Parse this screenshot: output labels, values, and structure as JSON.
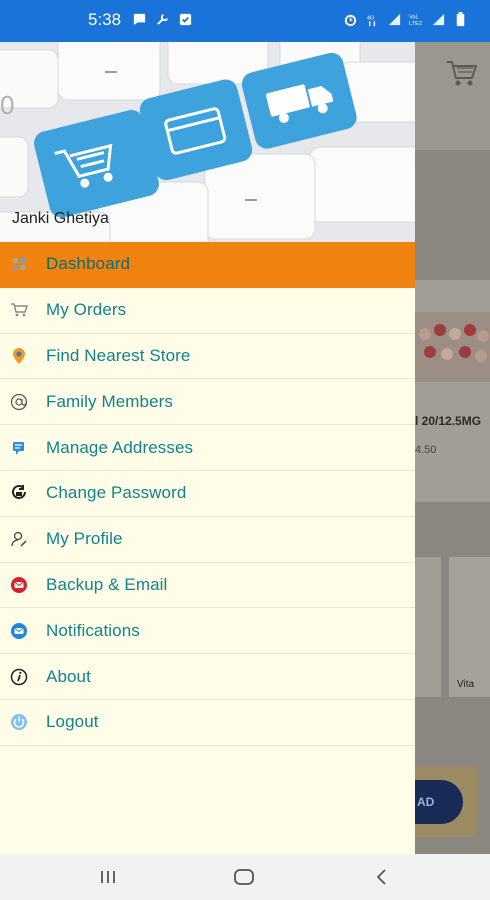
{
  "status_bar": {
    "time": "5:38",
    "icons_left": [
      "message-icon",
      "tool-icon",
      "check-box-icon"
    ],
    "icons_right": [
      "alarm-icon",
      "data-icon",
      "signal-icon",
      "volte-icon",
      "signal-icon",
      "battery-icon"
    ]
  },
  "drawer": {
    "user_name": "Janki Ghetiya",
    "menu_items": [
      {
        "label": "Dashboard",
        "icon": "dashboard-icon",
        "active": true
      },
      {
        "label": "My Orders",
        "icon": "cart-icon"
      },
      {
        "label": "Find Nearest Store",
        "icon": "location-pin-icon"
      },
      {
        "label": "Family Members",
        "icon": "at-sign-icon"
      },
      {
        "label": "Manage Addresses",
        "icon": "address-icon"
      },
      {
        "label": "Change Password",
        "icon": "password-refresh-icon"
      },
      {
        "label": "My Profile",
        "icon": "profile-icon"
      },
      {
        "label": "Backup & Email",
        "icon": "backup-icon"
      },
      {
        "label": "Notifications",
        "icon": "mail-icon"
      },
      {
        "label": "About",
        "icon": "info-icon"
      },
      {
        "label": "Logout",
        "icon": "power-icon"
      }
    ]
  },
  "background_app": {
    "product_text": "l 20/12.5MG",
    "price_text": "4.50",
    "tile_text": "Vita",
    "button_text": "AD"
  },
  "colors": {
    "status_bar": "#1a73d9",
    "active_item": "#f0830f",
    "menu_text": "#12838c",
    "drawer_bg": "#fffde8"
  }
}
